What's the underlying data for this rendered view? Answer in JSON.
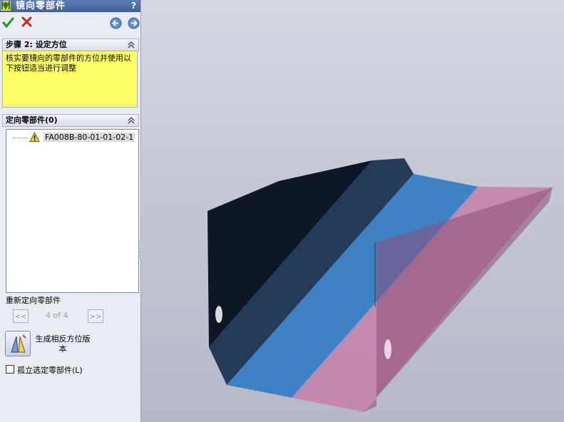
{
  "window": {
    "title": "镜向零部件",
    "help": "?"
  },
  "toolbar": {
    "ok_icon": "checkmark-icon",
    "cancel_icon": "cross-icon",
    "back_icon": "back-arrow-icon",
    "forward_icon": "forward-arrow-icon"
  },
  "step": {
    "title": "步骤 2: 设定方位",
    "message": "核实要镜向的零部件的方位并使用以下按钮适当进行调整"
  },
  "orient": {
    "title": "定向零部件(0)",
    "items": [
      {
        "label": "FA008B-80-01-01-02-1",
        "icon": "warning-icon"
      }
    ],
    "reorient_label": "重新定向零部件",
    "prev_label": "<<",
    "next_label": ">>",
    "counter": "4 of 4",
    "create_label": "生成相反方位版本",
    "isolate_label": "孤立选定零部件(L)",
    "isolate_checked": false
  },
  "colors": {
    "accent_title": "#4a6aa6",
    "message_bg": "#ffff66",
    "part_dark": "#0e1726",
    "part_blue": "#3e82c4",
    "mirror_pink": "#c77fa8"
  }
}
